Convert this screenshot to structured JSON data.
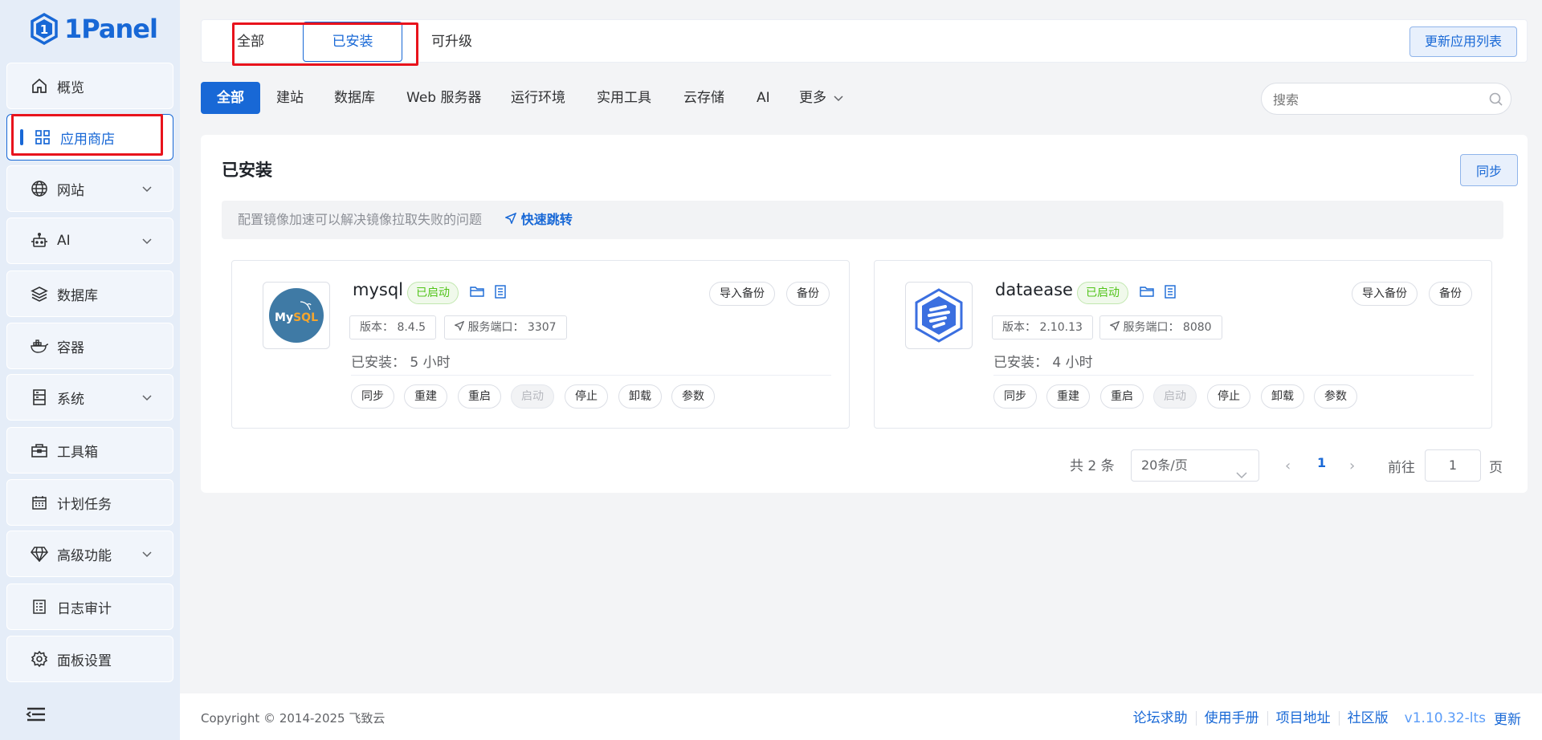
{
  "brand": {
    "name": "1Panel"
  },
  "sidebar": {
    "items": [
      {
        "label": "概览",
        "icon": "home-icon"
      },
      {
        "label": "应用商店",
        "icon": "grid-icon",
        "active": true
      },
      {
        "label": "网站",
        "icon": "globe-icon",
        "expandable": true
      },
      {
        "label": "AI",
        "icon": "robot-icon",
        "expandable": true
      },
      {
        "label": "数据库",
        "icon": "layers-icon"
      },
      {
        "label": "容器",
        "icon": "docker-icon"
      },
      {
        "label": "系统",
        "icon": "server-icon",
        "expandable": true
      },
      {
        "label": "工具箱",
        "icon": "toolbox-icon"
      },
      {
        "label": "计划任务",
        "icon": "calendar-icon"
      },
      {
        "label": "高级功能",
        "icon": "diamond-icon",
        "expandable": true
      },
      {
        "label": "日志审计",
        "icon": "log-icon"
      },
      {
        "label": "面板设置",
        "icon": "gear-icon"
      }
    ]
  },
  "top_tabs": {
    "tabs": [
      "全部",
      "已安装",
      "可升级"
    ],
    "active": "已安装",
    "refresh_label": "更新应用列表"
  },
  "filters": {
    "tabs": [
      "全部",
      "建站",
      "数据库",
      "Web 服务器",
      "运行环境",
      "实用工具",
      "云存储",
      "AI",
      "更多"
    ],
    "active": "全部",
    "search_placeholder": "搜索"
  },
  "panel": {
    "title": "已安装",
    "sync_label": "同步",
    "notice": "配置镜像加速可以解决镜像拉取失败的问题",
    "notice_link": "快速跳转"
  },
  "apps": [
    {
      "name": "mysql",
      "status": "已启动",
      "version_label": "版本：",
      "version": "8.4.5",
      "port_label": "服务端口：",
      "port": "3307",
      "installed_label": "已安装：",
      "installed_time": "5 小时",
      "top_buttons": [
        "导入备份",
        "备份"
      ],
      "actions": [
        "同步",
        "重建",
        "重启",
        "启动",
        "停止",
        "卸载",
        "参数"
      ],
      "disabled_action": "启动",
      "logo_text": "MySQL"
    },
    {
      "name": "dataease",
      "status": "已启动",
      "version_label": "版本：",
      "version": "2.10.13",
      "port_label": "服务端口：",
      "port": "8080",
      "installed_label": "已安装：",
      "installed_time": "4 小时",
      "top_buttons": [
        "导入备份",
        "备份"
      ],
      "actions": [
        "同步",
        "重建",
        "重启",
        "启动",
        "停止",
        "卸载",
        "参数"
      ],
      "disabled_action": "启动"
    }
  ],
  "pagination": {
    "total": "共 2 条",
    "page_size": "20条/页",
    "current_page": "1",
    "goto_label": "前往",
    "goto_value": "1",
    "page_suffix": "页"
  },
  "footer": {
    "copyright": "Copyright © 2014-2025 飞致云",
    "links": [
      "论坛求助",
      "使用手册",
      "项目地址",
      "社区版"
    ],
    "version": "v1.10.32-lts",
    "update": "更新"
  },
  "colors": {
    "primary": "#1868d6",
    "success": "#52c41a",
    "highlight": "#e8131c"
  }
}
